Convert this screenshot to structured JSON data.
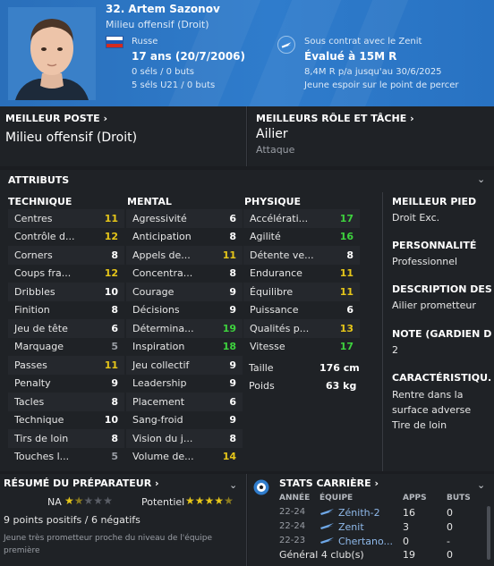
{
  "player": {
    "name": "32. Artem Sazonov",
    "position": "Milieu offensif (Droit)",
    "nationality": "Russe",
    "age": "17 ans (20/7/2006)",
    "caps": "0 séls / 0 buts",
    "u21_caps": "5 séls U21 / 0 buts",
    "contract": "Sous contrat avec le Zenit",
    "value": "Évalué à 15M R",
    "wage": "8,4M R p/a jusqu'au 30/6/2025",
    "status": "Jeune espoir sur le point de percer"
  },
  "best_position": {
    "title": "MEILLEUR POSTE",
    "value": "Milieu offensif (Droit)"
  },
  "best_role": {
    "title": "MEILLEURS RÔLE ET TÂCHE",
    "role": "Ailier",
    "duty": "Attaque"
  },
  "attributes": {
    "title": "ATTRIBUTS",
    "technical": {
      "title": "TECHNIQUE",
      "rows": [
        {
          "name": "Centres",
          "value": "11",
          "tone": "y"
        },
        {
          "name": "Contrôle d...",
          "value": "12",
          "tone": "y"
        },
        {
          "name": "Corners",
          "value": "8",
          "tone": "n"
        },
        {
          "name": "Coups fra...",
          "value": "12",
          "tone": "y"
        },
        {
          "name": "Dribbles",
          "value": "10",
          "tone": "n"
        },
        {
          "name": "Finition",
          "value": "8",
          "tone": "n"
        },
        {
          "name": "Jeu de tête",
          "value": "6",
          "tone": "n"
        },
        {
          "name": "Marquage",
          "value": "5",
          "tone": "d"
        },
        {
          "name": "Passes",
          "value": "11",
          "tone": "y"
        },
        {
          "name": "Penalty",
          "value": "9",
          "tone": "n"
        },
        {
          "name": "Tacles",
          "value": "8",
          "tone": "n"
        },
        {
          "name": "Technique",
          "value": "10",
          "tone": "n"
        },
        {
          "name": "Tirs de loin",
          "value": "8",
          "tone": "n"
        },
        {
          "name": "Touches l...",
          "value": "5",
          "tone": "d"
        }
      ]
    },
    "mental": {
      "title": "MENTAL",
      "rows": [
        {
          "name": "Agressivité",
          "value": "6",
          "tone": "n"
        },
        {
          "name": "Anticipation",
          "value": "8",
          "tone": "n"
        },
        {
          "name": "Appels de...",
          "value": "11",
          "tone": "y"
        },
        {
          "name": "Concentra...",
          "value": "8",
          "tone": "n"
        },
        {
          "name": "Courage",
          "value": "9",
          "tone": "n"
        },
        {
          "name": "Décisions",
          "value": "9",
          "tone": "n"
        },
        {
          "name": "Détermina...",
          "value": "19",
          "tone": "g"
        },
        {
          "name": "Inspiration",
          "value": "18",
          "tone": "g"
        },
        {
          "name": "Jeu collectif",
          "value": "9",
          "tone": "n"
        },
        {
          "name": "Leadership",
          "value": "9",
          "tone": "n"
        },
        {
          "name": "Placement",
          "value": "6",
          "tone": "n"
        },
        {
          "name": "Sang-froid",
          "value": "9",
          "tone": "n"
        },
        {
          "name": "Vision du j...",
          "value": "8",
          "tone": "n"
        },
        {
          "name": "Volume de...",
          "value": "14",
          "tone": "y"
        }
      ]
    },
    "physical": {
      "title": "PHYSIQUE",
      "rows": [
        {
          "name": "Accélérati...",
          "value": "17",
          "tone": "g"
        },
        {
          "name": "Agilité",
          "value": "16",
          "tone": "g"
        },
        {
          "name": "Détente ve...",
          "value": "8",
          "tone": "n"
        },
        {
          "name": "Endurance",
          "value": "11",
          "tone": "y"
        },
        {
          "name": "Équilibre",
          "value": "11",
          "tone": "y"
        },
        {
          "name": "Puissance",
          "value": "6",
          "tone": "n"
        },
        {
          "name": "Qualités p...",
          "value": "13",
          "tone": "y"
        },
        {
          "name": "Vitesse",
          "value": "17",
          "tone": "g"
        }
      ],
      "height_label": "Taille",
      "height_value": "176 cm",
      "weight_label": "Poids",
      "weight_value": "63 kg"
    }
  },
  "side": {
    "foot_title": "MEILLEUR PIED",
    "foot_value": "Droit Exc.",
    "personality_title": "PERSONNALITÉ",
    "personality_value": "Professionnel",
    "description_title": "DESCRIPTION DES...",
    "description_value": "Ailier prometteur",
    "gk_title": "NOTE (GARDIEN DE...",
    "gk_value": "2",
    "traits_title": "CARACTÉRISTIQU...",
    "trait_1": "Rentre dans la surface adverse",
    "trait_2": "Tire de loin"
  },
  "scout": {
    "title": "RÉSUMÉ DU PRÉPARATEUR",
    "na_label": "NA",
    "na_stars": 1.5,
    "potential_label": "Potentiel",
    "potential_stars": 4.5,
    "summary": "9 points positifs / 6 négatifs",
    "comment": "Jeune très prometteur proche du niveau de l'équipe première"
  },
  "career": {
    "title": "STATS CARRIÈRE",
    "headers": {
      "year": "ANNÉE",
      "team": "ÉQUIPE",
      "apps": "APPS",
      "goals": "BUTS"
    },
    "rows": [
      {
        "year": "22-24",
        "team": "Zénith-2",
        "apps": "16",
        "goals": "0"
      },
      {
        "year": "22-24",
        "team": "Zenit",
        "apps": "3",
        "goals": "0"
      },
      {
        "year": "22-23",
        "team": "Chertano...",
        "apps": "0",
        "goals": "-"
      }
    ],
    "total_label": "Général 4 club(s)",
    "total_apps": "19",
    "total_goals": "0"
  },
  "colors": {
    "header_blue": "#2f7ccc",
    "value_yellow": "#e6c619",
    "value_green": "#3ed23e",
    "panel_bg": "#1f2226"
  }
}
